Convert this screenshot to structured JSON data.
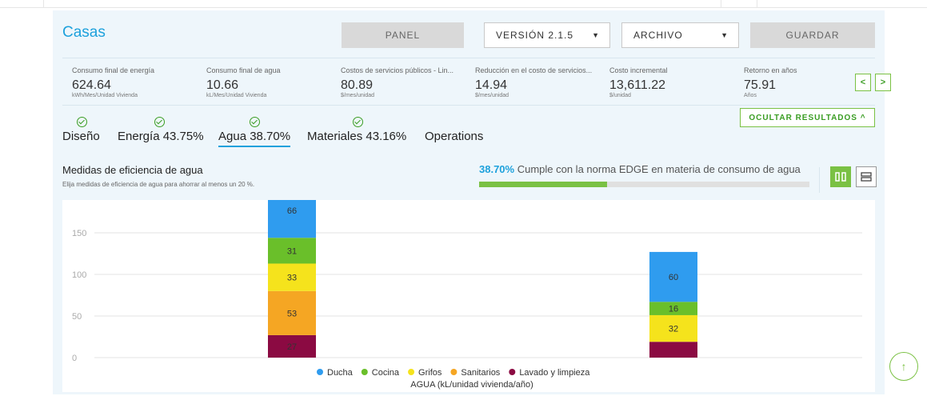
{
  "app": {
    "title": "Casas"
  },
  "toolbar": {
    "panel_label": "PANEL",
    "version_label": "VERSIÓN 2.1.5",
    "archivo_label": "ARCHIVO",
    "guardar_label": "GUARDAR"
  },
  "metrics": [
    {
      "label": "Consumo final de energía",
      "value": "624.64",
      "unit": "kWh/Mes/Unidad Vivienda"
    },
    {
      "label": "Consumo final de agua",
      "value": "10.66",
      "unit": "kL/Mes/Unidad Vivienda"
    },
    {
      "label": "Costos de servicios públicos - Lin...",
      "value": "80.89",
      "unit": "$/mes/unidad"
    },
    {
      "label": "Reducción en el costo de servicios...",
      "value": "14.94",
      "unit": "$/mes/unidad"
    },
    {
      "label": "Costo incremental",
      "value": "13,611.22",
      "unit": "$/unidad"
    },
    {
      "label": "Retorno en años",
      "value": "75.91",
      "unit": "Años"
    }
  ],
  "nav": {
    "prev": "<",
    "next": ">"
  },
  "ocultar_label": "OCULTAR RESULTADOS ^",
  "tabs": [
    {
      "label": "Diseño",
      "checked": true
    },
    {
      "label": "Energía 43.75%",
      "checked": true
    },
    {
      "label": "Agua 38.70%",
      "checked": true,
      "active": true
    },
    {
      "label": "Materiales 43.16%",
      "checked": true
    },
    {
      "label": "Operations",
      "checked": false
    }
  ],
  "section": {
    "title": "Medidas de eficiencia de agua",
    "subtitle": "Elija medidas de eficiencia de agua para ahorrar al menos un 20 %.",
    "pct_value": "38.70%",
    "pct_text": " Cumple con la norma EDGE en materia de consumo de agua",
    "progress_fraction": 0.387
  },
  "colors": {
    "accent": "#1da1dc",
    "green": "#7ac143"
  },
  "icons": {
    "check": "check-circle-icon",
    "view_grid": "columns-icon",
    "view_list": "rows-icon",
    "scroll_top": "arrow-up-icon"
  },
  "scroll_top_glyph": "↑",
  "chart_data": {
    "type": "bar",
    "stacked": true,
    "categories": [
      "",
      ""
    ],
    "series": [
      {
        "name": "Lavado y limpieza",
        "color": "#8b0a42",
        "values": [
          27,
          19
        ]
      },
      {
        "name": "Sanitarios",
        "color": "#f5a623",
        "values": [
          53,
          0
        ]
      },
      {
        "name": "Grifos",
        "color": "#f5e31c",
        "values": [
          33,
          32
        ]
      },
      {
        "name": "Cocina",
        "color": "#6abf2a",
        "values": [
          31,
          16
        ]
      },
      {
        "name": "Ducha",
        "color": "#2f9cef",
        "values": [
          66,
          60
        ]
      }
    ],
    "data_labels": [
      [
        "27",
        "53",
        "33",
        "31",
        "66"
      ],
      [
        "",
        "",
        "32",
        "16",
        "60"
      ]
    ],
    "yticks": [
      0,
      50,
      100,
      150
    ],
    "ylim": [
      0,
      188
    ],
    "xlabel": "AGUA (kL/unidad vivienda/año)",
    "legend_position": "bottom",
    "grid": true
  }
}
